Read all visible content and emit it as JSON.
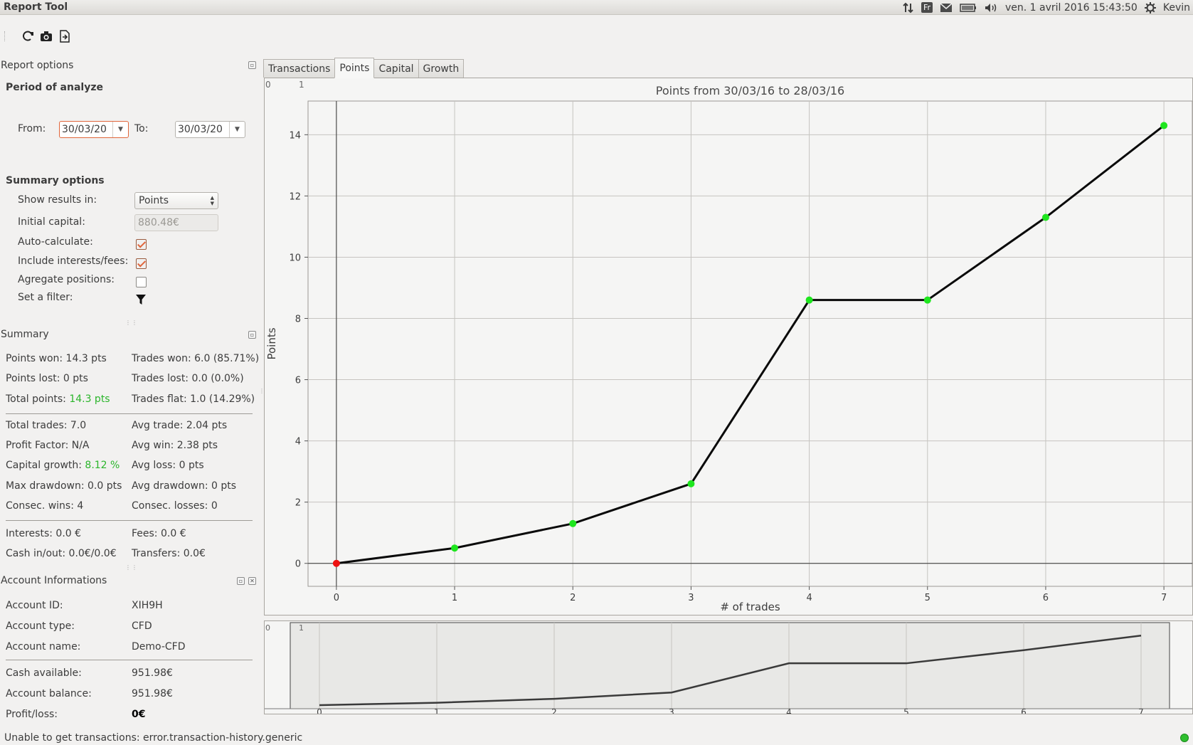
{
  "app": {
    "title": "Report Tool"
  },
  "tray": {
    "lang": "Fr",
    "datetime": "ven.  1 avril 2016 15:43:50",
    "user": "Kevin"
  },
  "report_options": {
    "title": "Report options",
    "period_label": "Period of analyze",
    "from_label": "From:",
    "from_value": "30/03/20",
    "to_label": "To:",
    "to_value": "30/03/20",
    "summary_options_label": "Summary options",
    "show_results_label": "Show results in:",
    "show_results_value": "Points",
    "initial_capital_label": "Initial capital:",
    "initial_capital_value": "880.48€",
    "auto_calc_label": "Auto-calculate:",
    "auto_calc_checked": true,
    "include_fees_label": "Include interests/fees:",
    "include_fees_checked": true,
    "aggregate_label": "Agregate positions:",
    "aggregate_checked": false,
    "filter_label": "Set a filter:"
  },
  "summary": {
    "title": "Summary",
    "points_won": "Points won: 14.3 pts",
    "trades_won": "Trades won: 6.0 (85.71%)",
    "points_lost": "Points lost: 0 pts",
    "trades_lost": "Trades lost: 0.0 (0.0%)",
    "total_points_label": "Total points: ",
    "total_points_value": "14.3 pts",
    "trades_flat": "Trades flat: 1.0 (14.29%)",
    "total_trades": "Total trades: 7.0",
    "avg_trade": "Avg trade: 2.04 pts",
    "profit_factor": "Profit Factor: N/A",
    "avg_win": "Avg win: 2.38 pts",
    "capital_growth_label": "Capital growth: ",
    "capital_growth_value": "8.12 %",
    "avg_loss": "Avg loss: 0 pts",
    "max_drawdown": "Max drawdown: 0.0 pts",
    "avg_drawdown": "Avg drawdown: 0 pts",
    "consec_wins": "Consec. wins: 4",
    "consec_losses": "Consec. losses: 0",
    "interests": "Interests: 0.0 €",
    "fees": "Fees: 0.0 €",
    "cash_inout": "Cash in/out: 0.0€/0.0€",
    "transfers": "Transfers: 0.0€"
  },
  "account": {
    "title": "Account Informations",
    "id_label": "Account ID:",
    "id_value": "XIH9H",
    "type_label": "Account type:",
    "type_value": "CFD",
    "name_label": "Account name:",
    "name_value": "Demo-CFD",
    "cash_label": "Cash available:",
    "cash_value": "951.98€",
    "balance_label": "Account balance:",
    "balance_value": "951.98€",
    "pl_label": "Profit/loss:",
    "pl_value": "0€"
  },
  "tabs": [
    "Transactions",
    "Points",
    "Capital",
    "Growth"
  ],
  "active_tab": 1,
  "status": {
    "message": "Unable to get transactions: error.transaction-history.generic"
  },
  "colors": {
    "accent": "#e0653a",
    "positive": "#2bb52b",
    "marker_green": "#1ee61e",
    "marker_red": "#ee1111"
  },
  "chart_data": {
    "type": "line",
    "title": "Points from 30/03/16 to 28/03/16",
    "xlabel": "# of trades",
    "ylabel": "Points",
    "corner_labels": [
      "0",
      "1"
    ],
    "x": [
      0,
      1,
      2,
      3,
      4,
      5,
      6,
      7
    ],
    "y": [
      0,
      0.5,
      1.3,
      2.6,
      8.6,
      8.6,
      11.3,
      14.3
    ],
    "marker_colors": [
      "red",
      "green",
      "green",
      "green",
      "green",
      "green",
      "green",
      "green"
    ],
    "xlim": [
      -0.24,
      7.24
    ],
    "ylim": [
      -0.75,
      15.1
    ],
    "xticks": [
      0,
      1,
      2,
      3,
      4,
      5,
      6,
      7
    ],
    "yticks": [
      0,
      2,
      4,
      6,
      8,
      10,
      12,
      14
    ],
    "grid": true
  }
}
